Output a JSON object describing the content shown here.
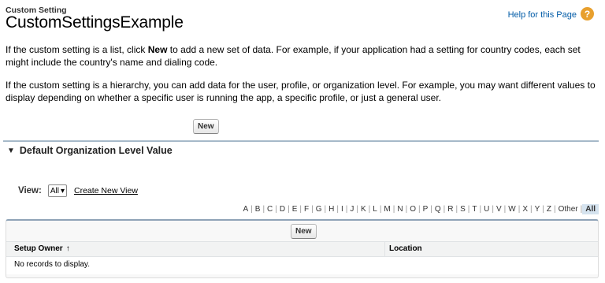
{
  "header": {
    "subtitle": "Custom Setting",
    "title": "CustomSettingsExample",
    "help_link": "Help for this Page",
    "help_icon": "?"
  },
  "intro": {
    "p1_before": "If the custom setting is a list, click ",
    "p1_bold": "New",
    "p1_after": " to add a new set of data. For example, if your application had a setting for country codes, each set might include the country's name and dialing code.",
    "p2": "If the custom setting is a hierarchy, you can add data for the user, profile, or organization level. For example, you may want different values to display depending on whether a specific user is running the app, a specific profile, or just a general user."
  },
  "top_new_button": "New",
  "section": {
    "title": "Default Organization Level Value",
    "collapse_glyph": "▼"
  },
  "view": {
    "label": "View:",
    "selected": "All",
    "dropdown_glyph": "▾",
    "create_link": "Create New View"
  },
  "alpha": [
    "A",
    "B",
    "C",
    "D",
    "E",
    "F",
    "G",
    "H",
    "I",
    "J",
    "K",
    "L",
    "M",
    "N",
    "O",
    "P",
    "Q",
    "R",
    "S",
    "T",
    "U",
    "V",
    "W",
    "X",
    "Y",
    "Z",
    "Other",
    "All"
  ],
  "alpha_selected": "All",
  "list": {
    "new_button": "New",
    "columns": [
      "Setup Owner",
      "Location"
    ],
    "sort_glyph": "↑",
    "empty_message": "No records to display."
  }
}
